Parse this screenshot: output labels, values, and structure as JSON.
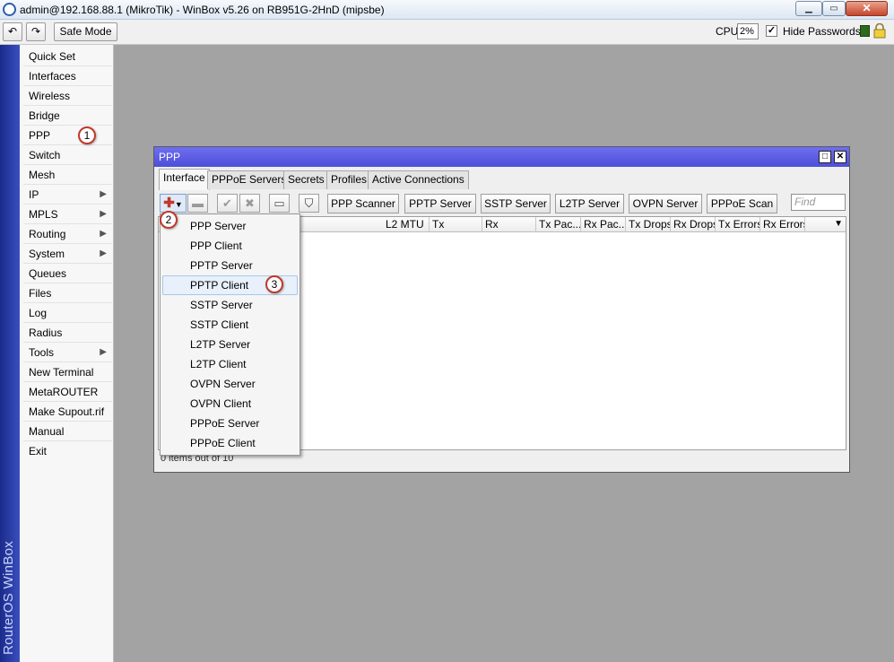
{
  "window": {
    "title": "admin@192.168.88.1 (MikroTik) - WinBox v5.26 on RB951G-2HnD (mipsbe)"
  },
  "toolbar": {
    "safe_mode": "Safe Mode",
    "cpu_label": "CPU:",
    "cpu_value": "2%",
    "hide_passwords": "Hide Passwords",
    "hide_passwords_checked": true
  },
  "banner": {
    "text": "RouterOS WinBox",
    "color": "#2a3ba8"
  },
  "menu": {
    "items": [
      {
        "label": "Quick Set"
      },
      {
        "label": "Interfaces"
      },
      {
        "label": "Wireless"
      },
      {
        "label": "Bridge"
      },
      {
        "label": "PPP"
      },
      {
        "label": "Switch"
      },
      {
        "label": "Mesh"
      },
      {
        "label": "IP",
        "submenu": true
      },
      {
        "label": "MPLS",
        "submenu": true
      },
      {
        "label": "Routing",
        "submenu": true
      },
      {
        "label": "System",
        "submenu": true
      },
      {
        "label": "Queues"
      },
      {
        "label": "Files"
      },
      {
        "label": "Log"
      },
      {
        "label": "Radius"
      },
      {
        "label": "Tools",
        "submenu": true
      },
      {
        "label": "New Terminal"
      },
      {
        "label": "MetaROUTER"
      },
      {
        "label": "Make Supout.rif"
      },
      {
        "label": "Manual"
      },
      {
        "label": "Exit"
      }
    ]
  },
  "callouts": {
    "one": "1",
    "two": "2",
    "three": "3"
  },
  "ppp_window": {
    "title": "PPP",
    "title_bar_color": "#5b5ce6",
    "tabs": [
      {
        "label": "Interface",
        "active": true
      },
      {
        "label": "PPPoE Servers"
      },
      {
        "label": "Secrets"
      },
      {
        "label": "Profiles"
      },
      {
        "label": "Active Connections"
      }
    ],
    "buttons": {
      "ppp_scanner": "PPP Scanner",
      "pptp_server": "PPTP Server",
      "sstp_server": "SSTP Server",
      "l2tp_server": "L2TP Server",
      "ovpn_server": "OVPN Server",
      "pppoe_scan": "PPPoE Scan"
    },
    "find_placeholder": "Find",
    "columns": [
      "L2 MTU",
      "Tx",
      "Rx",
      "Tx Pac...",
      "Rx Pac...",
      "Tx Drops",
      "Rx Drops",
      "Tx Errors",
      "Rx Errors"
    ],
    "status": "0 items out of 10"
  },
  "add_menu": {
    "items": [
      "PPP Server",
      "PPP Client",
      "PPTP Server",
      "PPTP Client",
      "SSTP Server",
      "SSTP Client",
      "L2TP Server",
      "L2TP Client",
      "OVPN Server",
      "OVPN Client",
      "PPPoE Server",
      "PPPoE Client"
    ],
    "highlighted": "PPTP Client"
  }
}
